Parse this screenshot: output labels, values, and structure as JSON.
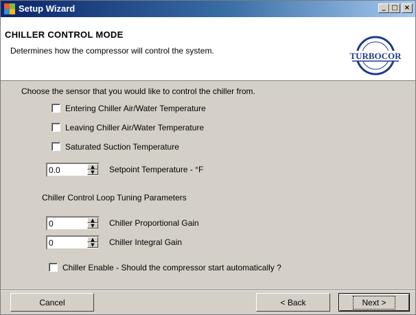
{
  "window": {
    "title": "Setup Wizard",
    "controls": {
      "minimize": "_",
      "maximize": "□",
      "close": "×"
    }
  },
  "header": {
    "title": "CHILLER CONTROL MODE",
    "subtitle": "Determines how the compressor will control the system.",
    "logo_text": "TURBOCOR"
  },
  "sensor": {
    "prompt": "Choose the sensor that you would like to control the chiller from.",
    "options": [
      {
        "label": "Entering Chiller Air/Water Temperature",
        "checked": false
      },
      {
        "label": "Leaving Chiller Air/Water Temperature",
        "checked": false
      },
      {
        "label": "Saturated Suction Temperature",
        "checked": false
      }
    ]
  },
  "setpoint": {
    "value": "0.0",
    "label": "Setpoint Temperature - °F"
  },
  "tuning": {
    "heading": "Chiller Control Loop Tuning Parameters",
    "proportional": {
      "value": "0",
      "label": "Chiller Proportional Gain"
    },
    "integral": {
      "value": "0",
      "label": "Chiller Integral Gain"
    }
  },
  "enable": {
    "label": "Chiller Enable - Should the compressor start automatically ?",
    "checked": false
  },
  "footer": {
    "cancel": "Cancel",
    "back": "< Back",
    "next": "Next >"
  },
  "colors": {
    "titlebar": "#0a246a",
    "face": "#d4d0c8",
    "logo_blue": "#1f3a8a"
  }
}
